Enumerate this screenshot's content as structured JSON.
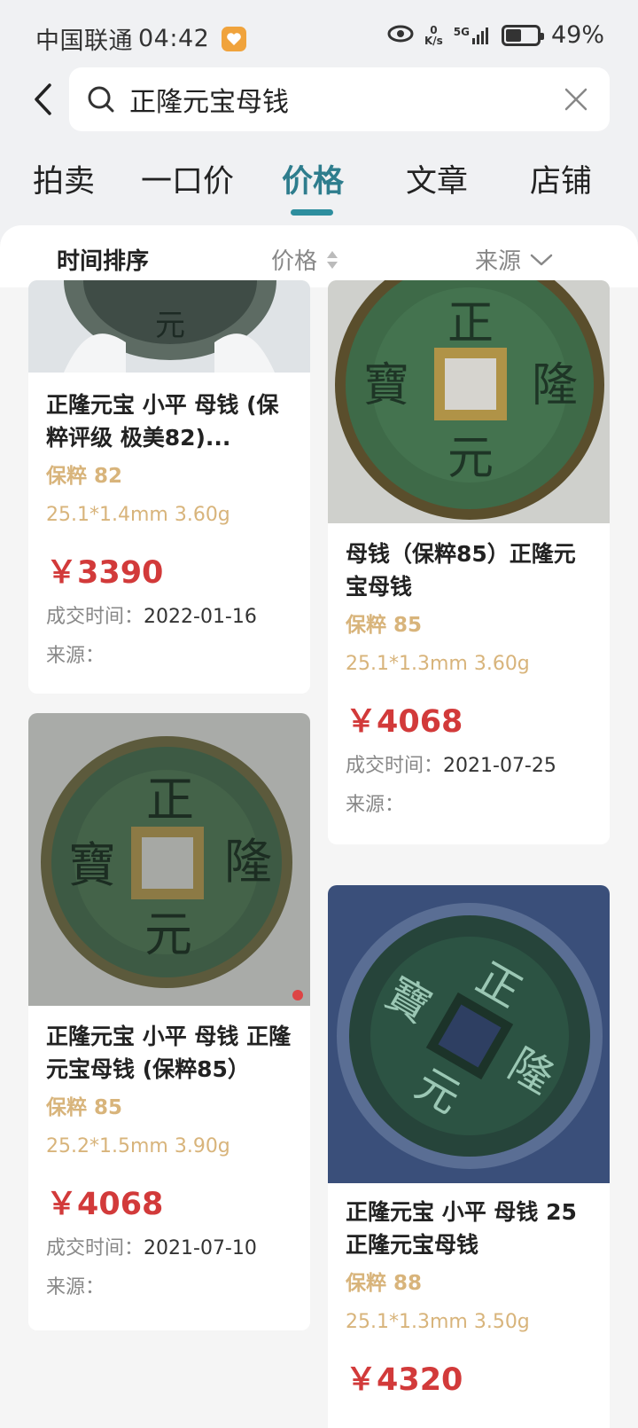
{
  "status_bar": {
    "carrier": "中国联通",
    "time": "04:42",
    "net_speed_value": "0",
    "net_speed_unit": "K/s",
    "signal_label": "5G",
    "battery_level": 0.49,
    "battery_text": "49%"
  },
  "search": {
    "query": "正隆元宝母钱"
  },
  "tabs": [
    {
      "label": "拍卖"
    },
    {
      "label": "一口价"
    },
    {
      "label": "价格"
    },
    {
      "label": "文章"
    },
    {
      "label": "店铺"
    }
  ],
  "active_tab": "价格",
  "sort_bar": {
    "time_sort": "时间排序",
    "price": "价格",
    "source": "来源"
  },
  "labels": {
    "deal_time": "成交时间：",
    "source": "来源："
  },
  "cards": [
    {
      "title": "正隆元宝 小平 母钱 (保粹评级 极美82)...",
      "grade": "保粹 82",
      "spec": "25.1*1.4mm 3.60g",
      "price": "￥3390",
      "deal_date": "2022-01-16"
    },
    {
      "title": "母钱（保粹85）正隆元宝母钱",
      "grade": "保粹 85",
      "spec": "25.1*1.3mm 3.60g",
      "price": "￥4068",
      "deal_date": "2021-07-25"
    },
    {
      "title": "正隆元宝 小平 母钱 正隆元宝母钱 (保粹85）",
      "grade": "保粹 85",
      "spec": "25.2*1.5mm 3.90g",
      "price": "￥4068",
      "deal_date": "2021-07-10"
    },
    {
      "title": "正隆元宝 小平 母钱 25正隆元宝母钱",
      "grade": "保粹 88",
      "spec": "25.1*1.3mm 3.50g",
      "price": "￥4320"
    }
  ],
  "coin_inscription": {
    "top": "正",
    "right": "隆",
    "bottom": "元",
    "left": "寶"
  },
  "colors": {
    "accent": "#2e8e9e",
    "price": "#d23a3a",
    "grade": "#d8b47b"
  }
}
